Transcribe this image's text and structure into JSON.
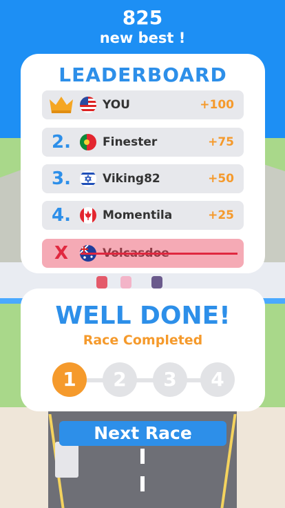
{
  "score": {
    "value": "825",
    "subtitle": "new best !"
  },
  "leaderboard": {
    "title": "LEADERBOARD",
    "rows": [
      {
        "rank": "",
        "icon": "crown-icon",
        "flag": "us-flag-icon",
        "name": "YOU",
        "points": "+100"
      },
      {
        "rank": "2.",
        "flag": "portugal-flag-icon",
        "name": "Finester",
        "points": "+75"
      },
      {
        "rank": "3.",
        "flag": "israel-flag-icon",
        "name": "Viking82",
        "points": "+50"
      },
      {
        "rank": "4.",
        "flag": "canada-flag-icon",
        "name": "Momentila",
        "points": "+25"
      },
      {
        "rank": "X",
        "flag": "australia-flag-icon",
        "name": "Volcasdoe",
        "points": "",
        "eliminated": true
      }
    ]
  },
  "result": {
    "title": "WELL DONE!",
    "subtitle": "Race Completed",
    "steps": [
      "1",
      "2",
      "3",
      "4"
    ],
    "active_step": 1
  },
  "next_button": {
    "label": "Next Race"
  },
  "colors": {
    "accent_blue": "#2d8fe9",
    "accent_orange": "#f59a2c",
    "eliminated_red": "#e0283f",
    "eliminated_bg": "#f5aab5"
  }
}
